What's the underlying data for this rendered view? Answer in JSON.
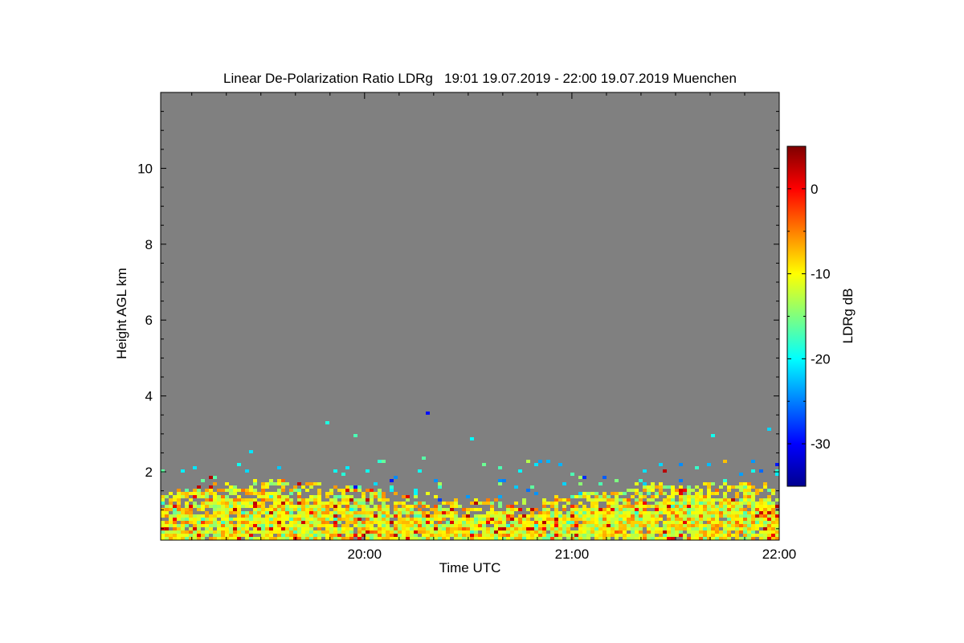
{
  "chart_data": {
    "type": "heatmap",
    "title": "Linear De-Polarization Ratio LDRg   19:01 19.07.2019 - 22:00 19.07.2019 Muenchen",
    "xlabel": "Time UTC",
    "ylabel": "Height AGL km",
    "colorbar_label": "LDRg dB",
    "x_range": [
      "19:01",
      "22:00"
    ],
    "x_ticks": [
      "20:00",
      "21:00",
      "22:00"
    ],
    "ylim": [
      0.2,
      12
    ],
    "y_ticks": [
      2,
      4,
      6,
      8,
      10
    ],
    "colorbar_range": [
      -35,
      5
    ],
    "colorbar_ticks": [
      0,
      -10,
      -20,
      -30
    ],
    "no_data_color": "#808080",
    "colormap": "jet",
    "layer_top_km": 1.7,
    "sparse_echo_top_km": 2.4,
    "dominant_ldr_db": [
      -15,
      -5
    ]
  }
}
